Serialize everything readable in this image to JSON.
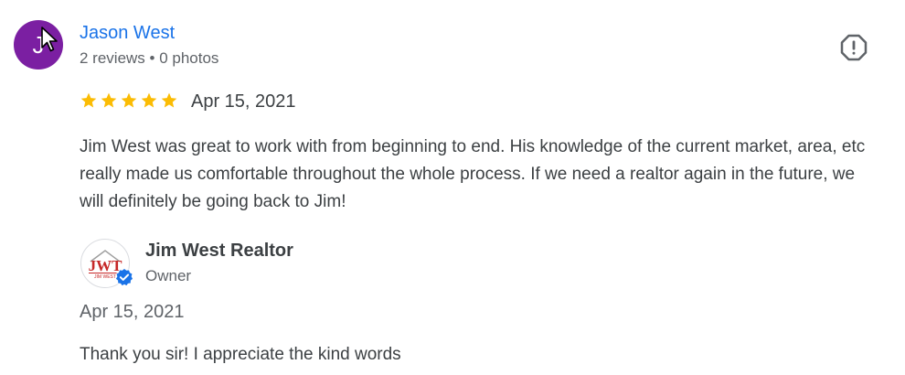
{
  "review": {
    "reviewer": {
      "initial": "J",
      "name": "Jason West",
      "meta": "2 reviews • 0 photos",
      "avatar_color": "#7b1fa2"
    },
    "rating": 5,
    "rating_max": 5,
    "date": "Apr 15, 2021",
    "text": "Jim West was great to work with from beginning to end. His knowledge of the current market, area, etc really made us comfortable throughout the whole process. If we need a realtor again in the future, we will definitely be going back to Jim!",
    "flag_icon": "report-flag-icon"
  },
  "owner_response": {
    "name": "Jim West Realtor",
    "role": "Owner",
    "logo_text": "JWT",
    "logo_subtext": "JIM WEST",
    "verified_icon": "verified-badge-icon",
    "date": "Apr 15, 2021",
    "text": "Thank you sir! I appreciate the kind words"
  },
  "colors": {
    "star": "#fbbc04",
    "link": "#1a73e8",
    "verified": "#1a73e8",
    "logo_red": "#c62828"
  }
}
